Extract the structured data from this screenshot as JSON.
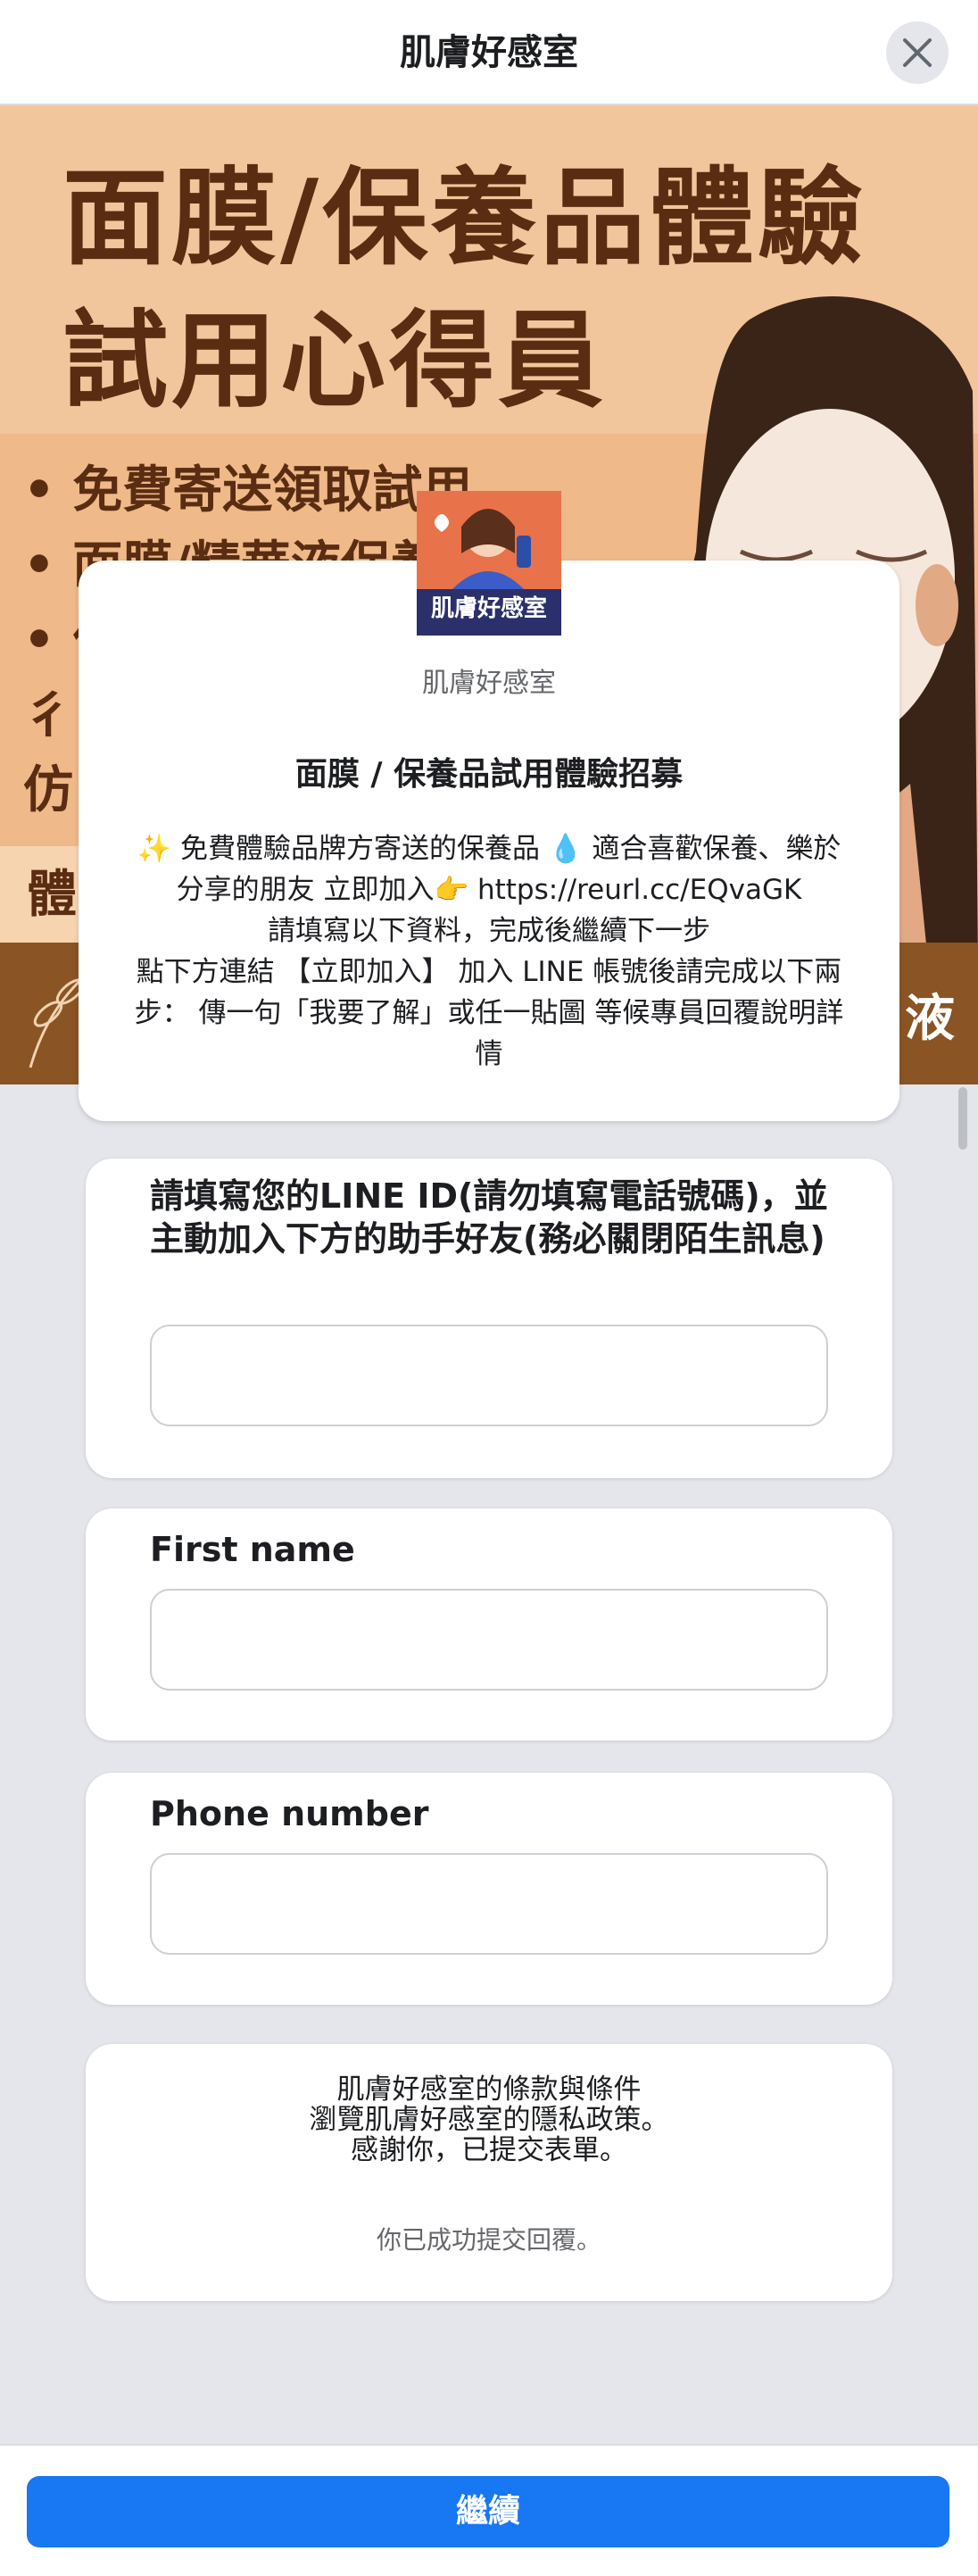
{
  "header": {
    "title": "肌膚好感室",
    "close_icon": "close-icon"
  },
  "hero": {
    "headline_line1": "面膜/保養品體驗",
    "headline_line2": "試用心得員",
    "bullets": [
      "• 免費寄送領取試用",
      "• 面膜/精華液保養",
      "• 仿",
      "  彳",
      "  仿"
    ],
    "strip_label": "體",
    "brown_text": "液"
  },
  "intro": {
    "logo_text": "肌膚好感室",
    "page_name": "肌膚好感室",
    "form_title": "面膜 / 保養品試用體驗招募",
    "description_lines": [
      "✨ 免費體驗品牌方寄送的保養品 💧 適合喜歡保養、樂於分享的朋友 立即加入👉 https://reurl.cc/EQvaGK",
      "請填寫以下資料，完成後繼續下一步",
      "點下方連結 【立即加入】 加入 LINE 帳號後請完成以下兩步： 傳一句「我要了解」或任一貼圖 等候專員回覆說明詳情"
    ]
  },
  "questions": [
    {
      "label": "請填寫您的LINE ID(請勿填寫電話號碼)，並主動加入下方的助手好友(務必關閉陌生訊息)",
      "value": ""
    },
    {
      "label": "First name",
      "value": ""
    },
    {
      "label": "Phone number",
      "value": ""
    }
  ],
  "footer": {
    "terms": "肌膚好感室的條款與條件",
    "privacy": "瀏覽肌膚好感室的隱私政策。",
    "thanks": "感謝你，已提交表單。",
    "success": "你已成功提交回覆。"
  },
  "bottom": {
    "continue_label": "繼續",
    "accent_color": "#1877f2"
  }
}
